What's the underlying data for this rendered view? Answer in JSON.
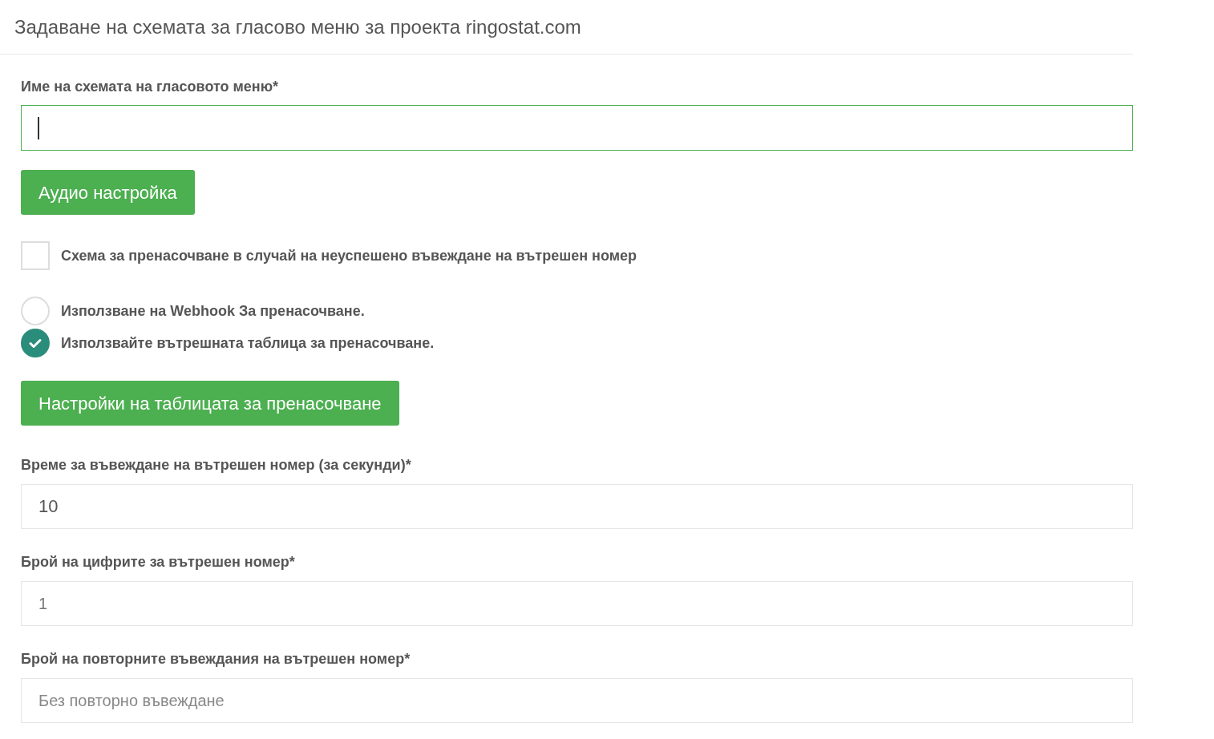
{
  "title": "Задаване на схемата за гласово меню за проекта ringostat.com",
  "name_field": {
    "label": "Име на схемата на гласовото меню*",
    "focused": true
  },
  "audio_button": "Аудио настройка",
  "fallback_checkbox": {
    "label": "Схема за пренасочване в случай на неуспешено въвеждане на вътрешен номер",
    "checked": false
  },
  "redirect_options": [
    {
      "label": "Използване на Webhook За пренасочване.",
      "selected": false
    },
    {
      "label": "Използвайте вътрешната таблица за пренасочване.",
      "selected": true
    }
  ],
  "table_button": "Настройки на таблицата за пренасочване",
  "fields": [
    {
      "label": "Време за въвеждане на вътрешен номер (за секунди)*",
      "value": "10"
    },
    {
      "label": "Брой на цифрите за вътрешен номер*",
      "value": "1"
    },
    {
      "label": "Брой на повторните въвеждания на вътрешен номер*",
      "placeholder": "Без повторно въвеждане"
    }
  ]
}
